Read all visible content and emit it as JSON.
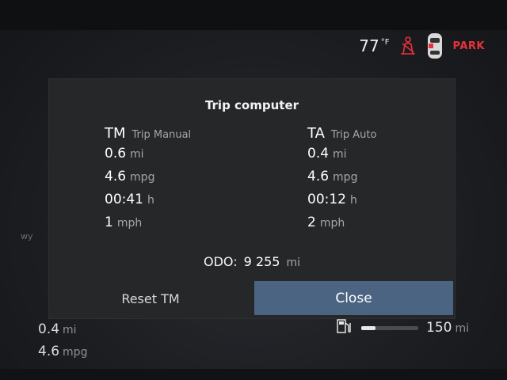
{
  "status": {
    "temperature": "77",
    "temperature_unit": "°F",
    "gear": "PARK",
    "warning_color": "#e8323a",
    "seatbelt_icon": "seatbelt-warning-icon",
    "car_icon": "car-top-view-icon"
  },
  "background": {
    "side_label": "wy"
  },
  "trip_computer": {
    "title": "Trip computer",
    "manual": {
      "code": "TM",
      "name": "Trip Manual",
      "rows": [
        {
          "value": "0.6",
          "unit": "mi"
        },
        {
          "value": "4.6",
          "unit": "mpg"
        },
        {
          "value": "00:41",
          "unit": "h"
        },
        {
          "value": "1",
          "unit": "mph"
        }
      ]
    },
    "auto": {
      "code": "TA",
      "name": "Trip Auto",
      "rows": [
        {
          "value": "0.4",
          "unit": "mi"
        },
        {
          "value": "4.6",
          "unit": "mpg"
        },
        {
          "value": "00:12",
          "unit": "h"
        },
        {
          "value": "2",
          "unit": "mph"
        }
      ]
    },
    "odometer": {
      "label": "ODO:",
      "value": "9 255",
      "unit": "mi"
    },
    "buttons": {
      "reset": "Reset TM",
      "close": "Close"
    },
    "accent_color": "#4b6482"
  },
  "cluster": {
    "distance": {
      "value": "0.4",
      "unit": "mi"
    },
    "economy": {
      "value": "4.6",
      "unit": "mpg"
    },
    "range": {
      "value": "150",
      "unit": "mi",
      "fuel_fraction": 0.25,
      "icon": "fuel-pump-icon"
    }
  }
}
